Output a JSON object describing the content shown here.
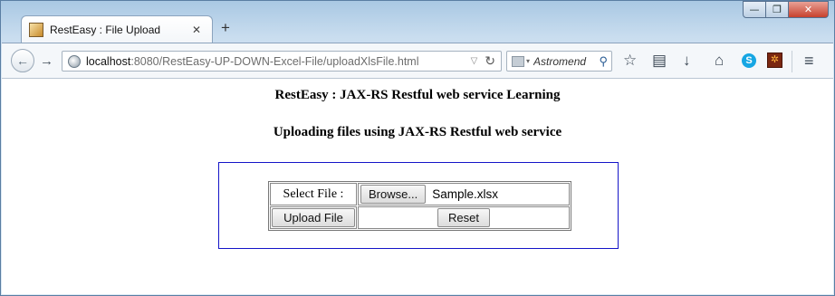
{
  "window": {
    "controls": {
      "minimize": "—",
      "maximize": "❐",
      "close": "✕"
    }
  },
  "tab": {
    "title": "RestEasy : File Upload",
    "close": "✕",
    "new_tab": "+"
  },
  "navbar": {
    "back_icon": "←",
    "forward_icon": "→",
    "url_host": "localhost",
    "url_rest": ":8080/RestEasy-UP-DOWN-Excel-File/uploadXlsFile.html",
    "url_dropdown": "▽",
    "reload_icon": "↻",
    "search_placeholder": "Astromend",
    "search_dropdown": "▾",
    "search_icon": "⚲",
    "star_icon": "☆",
    "reader_icon": "▤",
    "download_icon": "↓",
    "home_icon": "⌂",
    "skype_icon": "S",
    "extension_icon": "✲",
    "menu_icon": "≡"
  },
  "page": {
    "heading": "RestEasy : JAX-RS Restful web service Learning",
    "subheading": "Uploading files using JAX-RS Restful web service",
    "form": {
      "select_label": "Select File :",
      "browse_label": "Browse...",
      "file_name": "Sample.xlsx",
      "upload_label": "Upload File",
      "reset_label": "Reset"
    }
  }
}
